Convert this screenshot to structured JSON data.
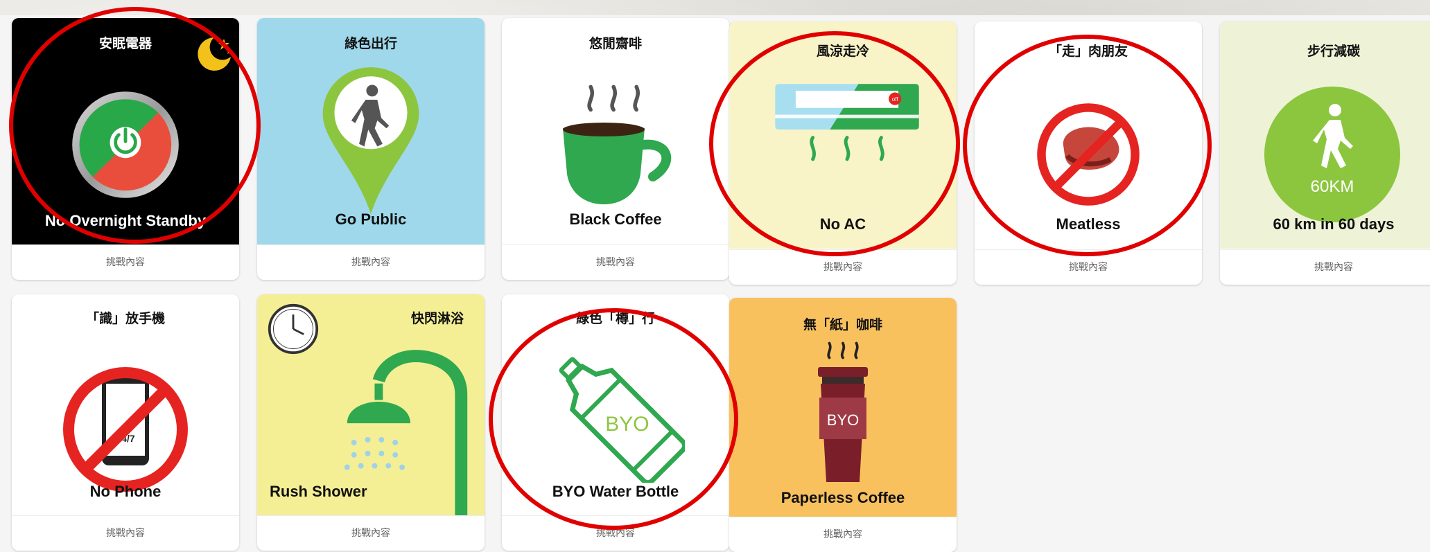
{
  "challenges": [
    {
      "title_zh": "安眠電器",
      "label_en": "No Overnight Standby",
      "footer": "挑戰內容"
    },
    {
      "title_zh": "綠色出行",
      "label_en": "Go Public",
      "footer": "挑戰內容"
    },
    {
      "title_zh": "悠閒齋啡",
      "label_en": "Black Coffee",
      "footer": "挑戰內容"
    },
    {
      "title_zh": "風涼走冷",
      "label_en": "No AC",
      "footer": "挑戰內容",
      "badge": "off"
    },
    {
      "title_zh": "「走」肉朋友",
      "label_en": "Meatless",
      "footer": "挑戰內容"
    },
    {
      "title_zh": "步行減碳",
      "label_en": "60 km in 60 days",
      "footer": "挑戰內容",
      "badge": "60KM"
    },
    {
      "title_zh": "「識」放手機",
      "label_en": "No Phone",
      "footer": "挑戰內容",
      "badge": "24/7"
    },
    {
      "title_zh": "快閃淋浴",
      "label_en": "Rush Shower",
      "footer": "挑戰內容"
    },
    {
      "title_zh": "綠色「樽」行",
      "label_en": "BYO Water Bottle",
      "footer": "挑戰內容",
      "badge": "BYO"
    },
    {
      "title_zh": "無「紙」咖啡",
      "label_en": "Paperless Coffee",
      "footer": "挑戰內容",
      "badge": "BYO"
    }
  ],
  "colors": {
    "highlight_ring": "#e00000",
    "green": "#2fa84f",
    "lime": "#8cc63f",
    "red_prohibit": "#e52421"
  }
}
